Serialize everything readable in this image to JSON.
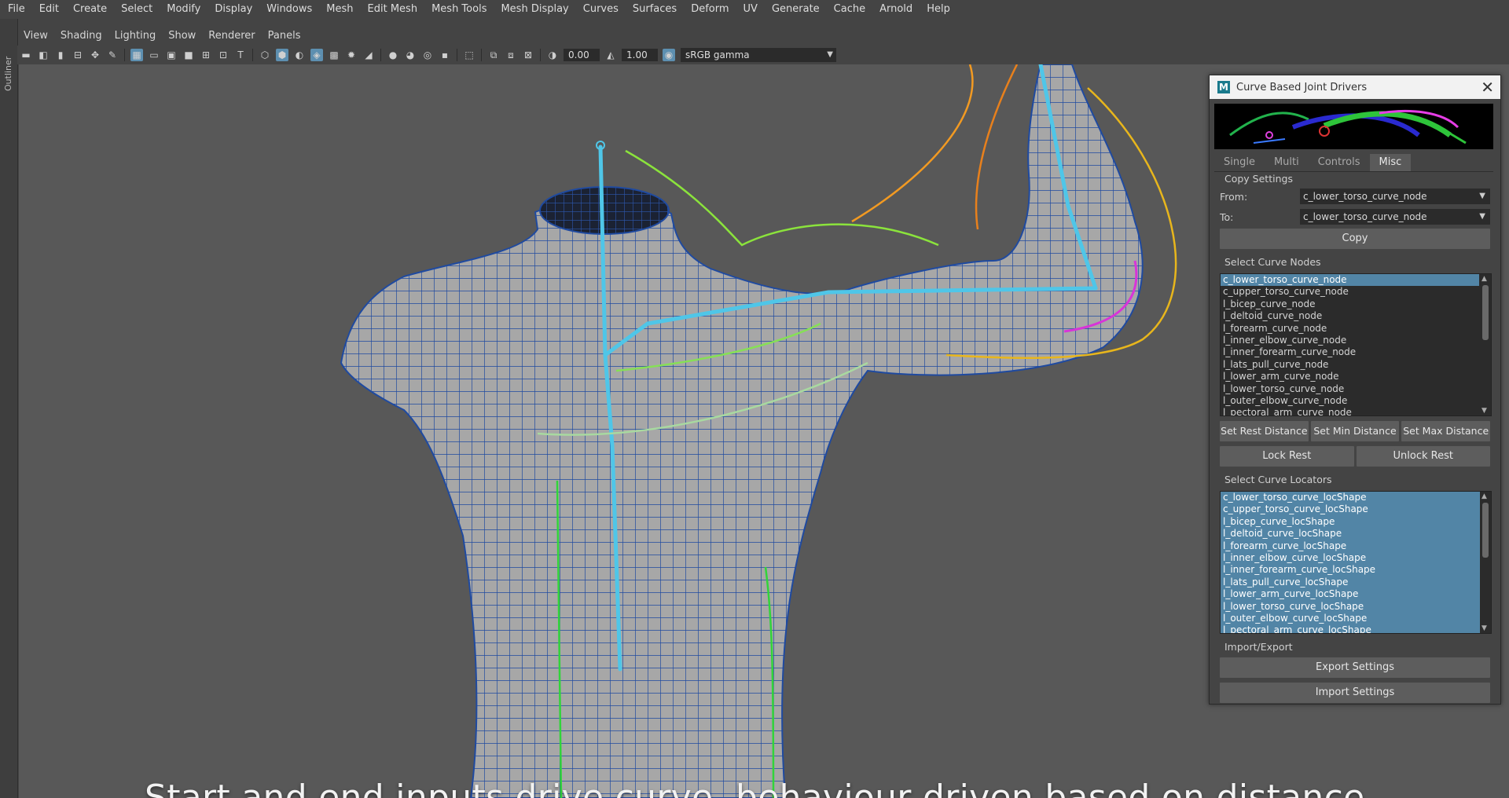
{
  "menu": [
    "File",
    "Edit",
    "Create",
    "Select",
    "Modify",
    "Display",
    "Windows",
    "Mesh",
    "Edit Mesh",
    "Mesh Tools",
    "Mesh Display",
    "Curves",
    "Surfaces",
    "Deform",
    "UV",
    "Generate",
    "Cache",
    "Arnold",
    "Help"
  ],
  "outliner_label": "Outliner",
  "panel_menu": [
    "View",
    "Shading",
    "Lighting",
    "Show",
    "Renderer",
    "Panels"
  ],
  "toolbar": {
    "exposure": "0.00",
    "gamma": "1.00",
    "color_space": "sRGB gamma"
  },
  "viewport": {
    "caption": "Start and end inputs drive curve, behaviour driven based on distance"
  },
  "tool_window": {
    "title": "Curve Based Joint Drivers",
    "logo": "M",
    "close": "✕",
    "tabs": [
      "Single",
      "Multi",
      "Controls",
      "Misc"
    ],
    "active_tab": "Misc",
    "copy_settings": {
      "header": "Copy Settings",
      "from_label": "From:",
      "from_value": "c_lower_torso_curve_node",
      "to_label": "To:",
      "to_value": "c_lower_torso_curve_node",
      "copy_button": "Copy"
    },
    "curve_nodes": {
      "header": "Select Curve Nodes",
      "items": [
        "c_lower_torso_curve_node",
        "c_upper_torso_curve_node",
        "l_bicep_curve_node",
        "l_deltoid_curve_node",
        "l_forearm_curve_node",
        "l_inner_elbow_curve_node",
        "l_inner_forearm_curve_node",
        "l_lats_pull_curve_node",
        "l_lower_arm_curve_node",
        "l_lower_torso_curve_node",
        "l_outer_elbow_curve_node",
        "l_pectoral_arm_curve_node"
      ],
      "selected_index": 0
    },
    "distance_buttons": [
      "Set Rest Distance",
      "Set Min Distance",
      "Set Max Distance"
    ],
    "rest_buttons": [
      "Lock Rest",
      "Unlock Rest"
    ],
    "curve_locators": {
      "header": "Select Curve Locators",
      "items": [
        "c_lower_torso_curve_locShape",
        "c_upper_torso_curve_locShape",
        "l_bicep_curve_locShape",
        "l_deltoid_curve_locShape",
        "l_forearm_curve_locShape",
        "l_inner_elbow_curve_locShape",
        "l_inner_forearm_curve_locShape",
        "l_lats_pull_curve_locShape",
        "l_lower_arm_curve_locShape",
        "l_lower_torso_curve_locShape",
        "l_outer_elbow_curve_locShape",
        "l_pectoral_arm_curve_locShape"
      ]
    },
    "import_export": {
      "header": "Import/Export",
      "export_button": "Export Settings",
      "import_button": "Import Settings"
    }
  }
}
